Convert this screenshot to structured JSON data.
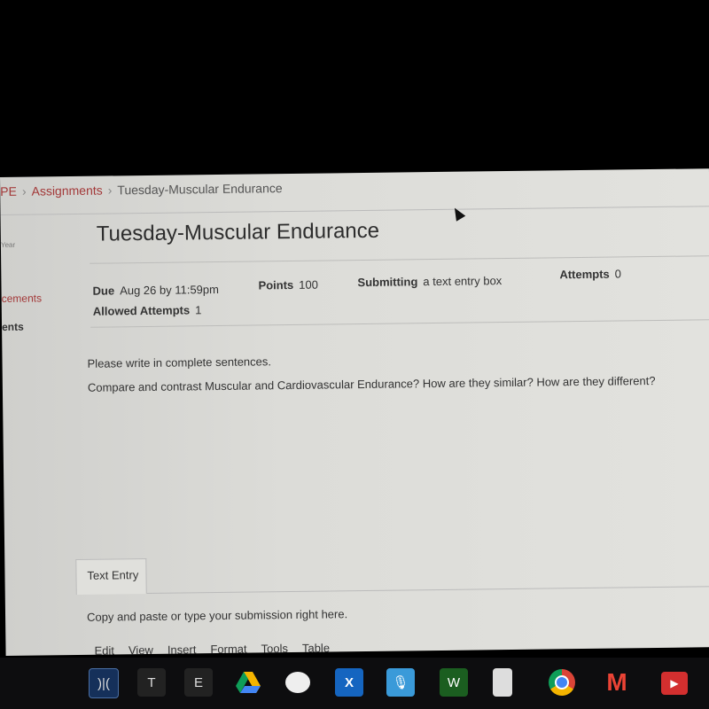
{
  "breadcrumb": {
    "course": "PE",
    "assignments": "Assignments",
    "current": "Tuesday-Muscular Endurance"
  },
  "sidebar": {
    "items": [
      {
        "label": "Year"
      },
      {
        "label": "cements"
      },
      {
        "label": "ents"
      }
    ]
  },
  "assignment": {
    "title": "Tuesday-Muscular Endurance",
    "due_label": "Due",
    "due_value": "Aug 26 by 11:59pm",
    "points_label": "Points",
    "points_value": "100",
    "submitting_label": "Submitting",
    "submitting_value": "a text entry box",
    "attempts_label": "Attempts",
    "attempts_value": "0",
    "allowed_label": "Allowed Attempts",
    "allowed_value": "1",
    "instructions": [
      "Please write in complete sentences.",
      "Compare and contrast Muscular and Cardiovascular Endurance? How are they similar? How are they different?"
    ]
  },
  "submission": {
    "tab": "Text Entry",
    "hint": "Copy and paste or type your submission right here.",
    "menu": [
      "Edit",
      "View",
      "Insert",
      "Format",
      "Tools",
      "Table"
    ]
  },
  "taskbar": {
    "apps": [
      {
        "name": "app-1",
        "label": ")|("
      },
      {
        "name": "text-app",
        "label": "T"
      },
      {
        "name": "e-app",
        "label": "E"
      },
      {
        "name": "google-drive"
      },
      {
        "name": "cloud-app"
      },
      {
        "name": "x-app"
      },
      {
        "name": "mic-app"
      },
      {
        "name": "graph-app"
      },
      {
        "name": "calculator-app"
      },
      {
        "name": "chrome"
      },
      {
        "name": "gmail"
      },
      {
        "name": "youtube"
      }
    ]
  }
}
